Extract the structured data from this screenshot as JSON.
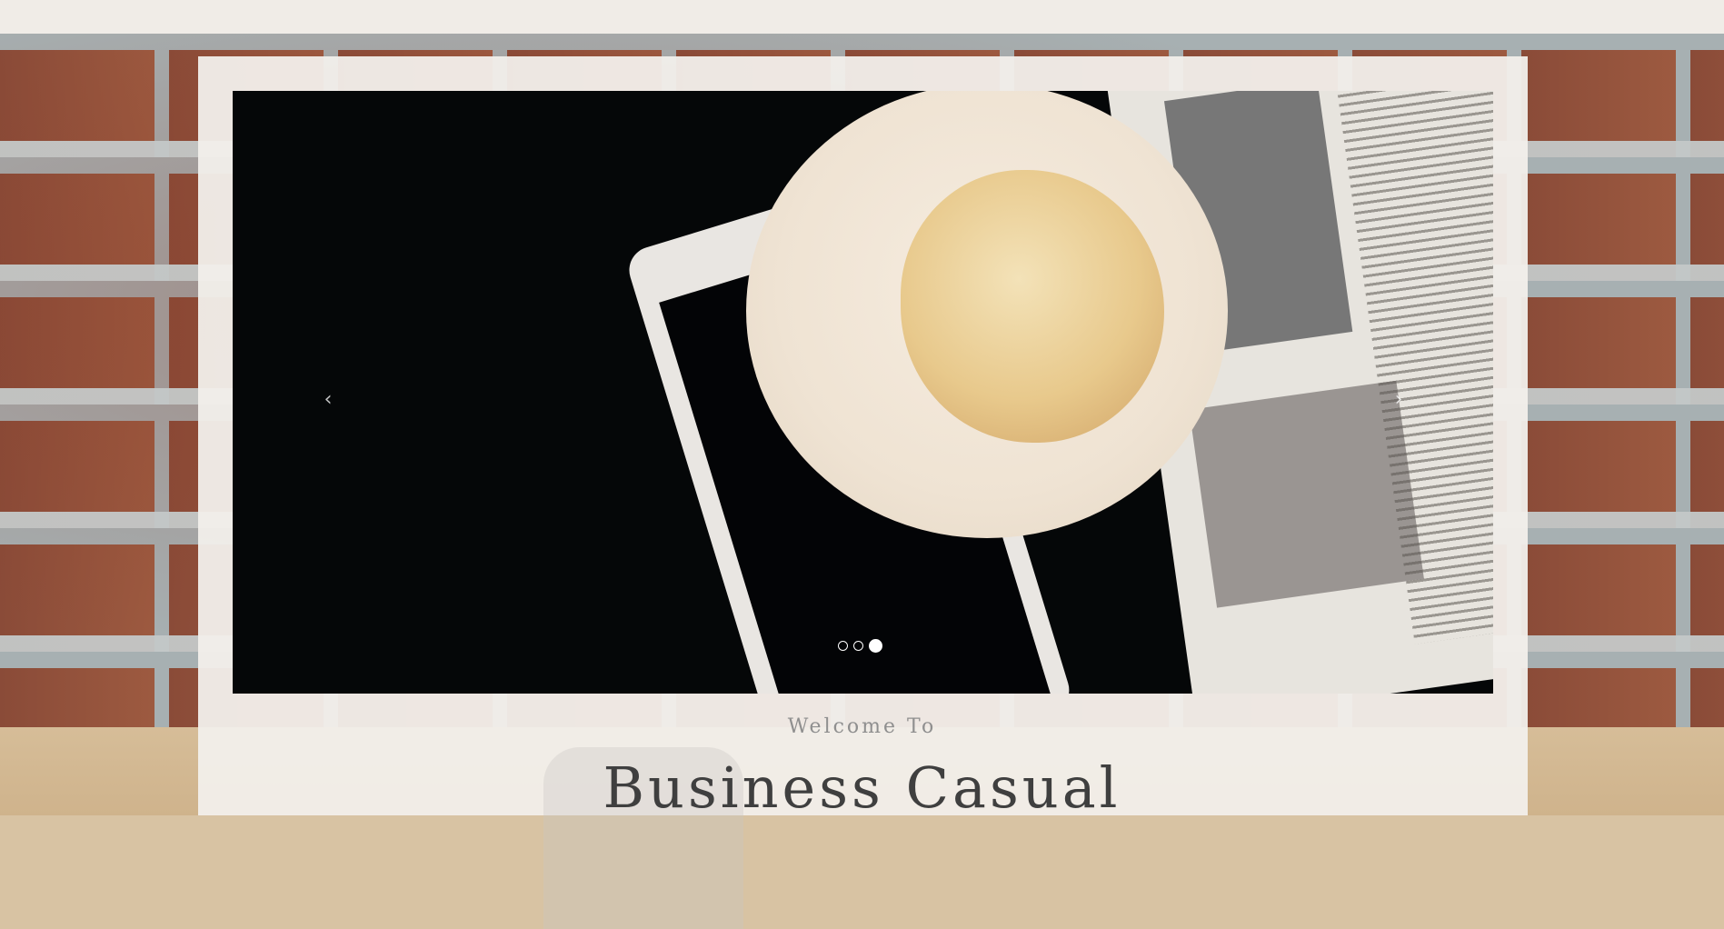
{
  "carousel": {
    "prev_label": "‹",
    "next_label": "›",
    "slide_count": 3,
    "active_slide": 3
  },
  "header": {
    "welcome": "Welcome To",
    "brand": "Business Casual"
  },
  "colors": {
    "panel": "#f2efeb",
    "heading": "#3f3f3f",
    "subheading": "#8f8f8f"
  }
}
